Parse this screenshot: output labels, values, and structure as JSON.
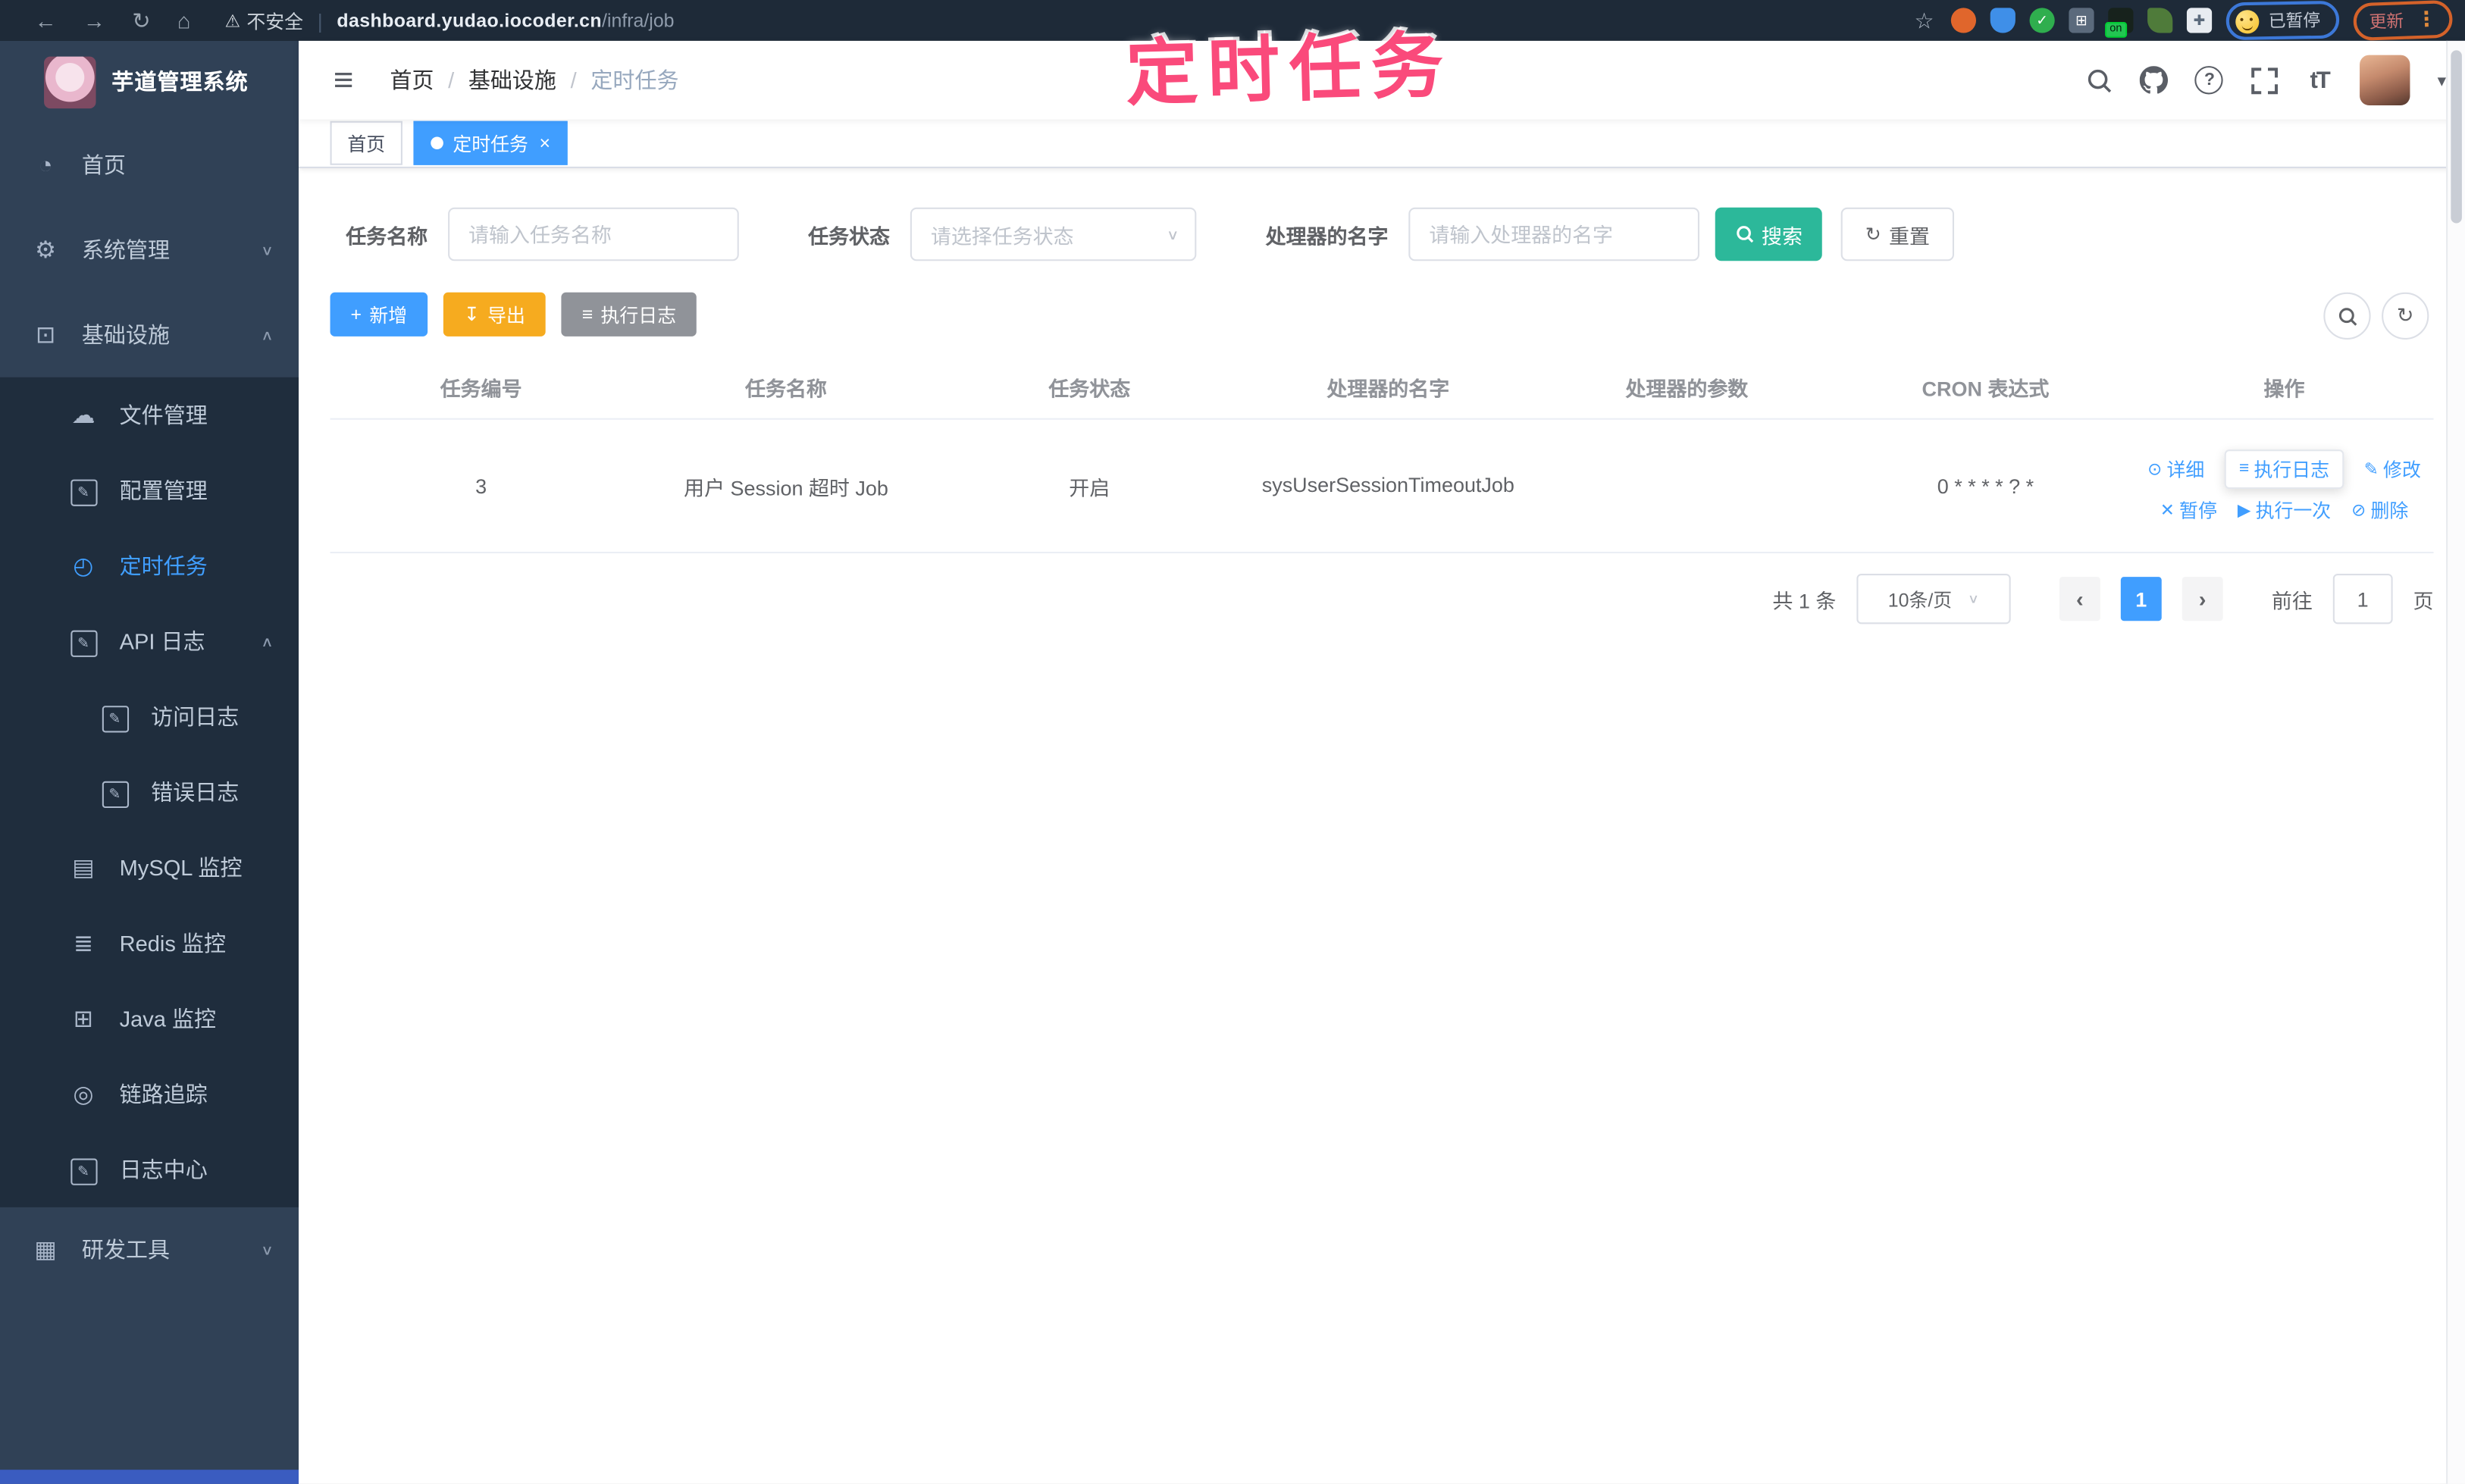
{
  "browser": {
    "security": "不安全",
    "url_host": "dashboard.yudao.iocoder.cn",
    "url_path": "/infra/job",
    "on_badge": "on",
    "tampermonkey_status": "已暂停",
    "update_label": "更新"
  },
  "icons": {
    "back": "←",
    "forward": "→",
    "reload": "↻",
    "home": "⌂",
    "warning": "⚠",
    "star": "☆",
    "check": "✓",
    "grid": "⊞",
    "puzzle": "✚",
    "menu_dots": "⋮",
    "hamburger": "≡",
    "chevron_down": "∨",
    "chevron_up": "∧",
    "caret_down": "▾",
    "close": "×",
    "question": "?",
    "text_size": "tT",
    "dashboard": "◔",
    "gear": "⚙",
    "monitor": "⊡",
    "cloud": "☁",
    "edit": "✎",
    "clock": "◴",
    "db": "▤",
    "layers": "≣",
    "java": "⊞",
    "eye": "◎",
    "tools": "▦",
    "plus": "+",
    "download": "↧",
    "list": "≡",
    "refresh": "↻",
    "view": "⊙",
    "pause": "✕",
    "play": "▶",
    "trash": "⊘",
    "prev": "‹",
    "next": "›"
  },
  "sidebar": {
    "app_title": "芋道管理系统",
    "menu": [
      {
        "label": "首页"
      },
      {
        "label": "系统管理"
      },
      {
        "label": "基础设施"
      },
      {
        "label": "文件管理"
      },
      {
        "label": "配置管理"
      },
      {
        "label": "定时任务"
      },
      {
        "label": "API 日志"
      },
      {
        "label": "访问日志"
      },
      {
        "label": "错误日志"
      },
      {
        "label": "MySQL 监控"
      },
      {
        "label": "Redis 监控"
      },
      {
        "label": "Java 监控"
      },
      {
        "label": "链路追踪"
      },
      {
        "label": "日志中心"
      },
      {
        "label": "研发工具"
      }
    ]
  },
  "header": {
    "breadcrumb": [
      "首页",
      "基础设施",
      "定时任务"
    ],
    "separator": "/"
  },
  "tabs": {
    "home": "首页",
    "active": "定时任务"
  },
  "annotation": {
    "title": "定时任务"
  },
  "filters": {
    "name_label": "任务名称",
    "name_placeholder": "请输入任务名称",
    "status_label": "任务状态",
    "status_placeholder": "请选择任务状态",
    "handler_label": "处理器的名字",
    "handler_placeholder": "请输入处理器的名字",
    "search": "搜索",
    "reset": "重置"
  },
  "toolbar": {
    "add": "新增",
    "export": "导出",
    "exec_log": "执行日志"
  },
  "table": {
    "headers": [
      "任务编号",
      "任务名称",
      "任务状态",
      "处理器的名字",
      "处理器的参数",
      "CRON 表达式",
      "操作"
    ],
    "rows": [
      {
        "id": "3",
        "name": "用户 Session 超时 Job",
        "status": "开启",
        "handler": "sysUserSessionTimeoutJob",
        "param": "",
        "cron": "0 * * * * ? *",
        "actions": [
          "详细",
          "执行日志",
          "修改",
          "暂停",
          "执行一次",
          "删除"
        ]
      }
    ]
  },
  "pagination": {
    "total": "共 1 条",
    "page_size": "10条/页",
    "page": "1",
    "goto_label": "前往",
    "goto_value": "1",
    "page_unit": "页"
  }
}
